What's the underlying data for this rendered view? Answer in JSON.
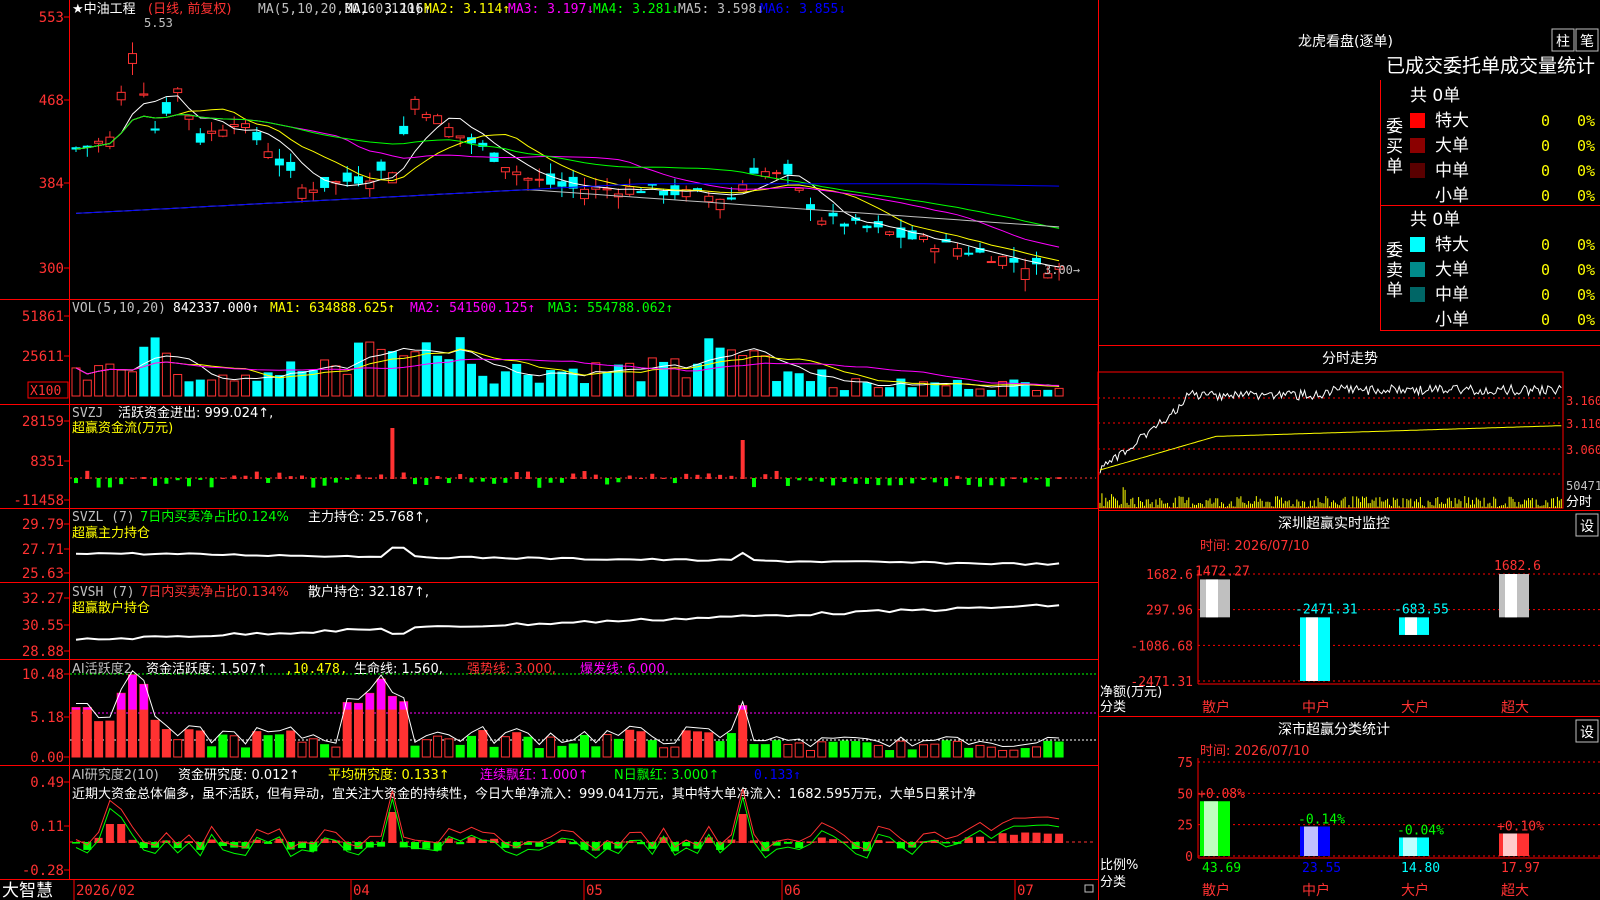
{
  "colors": {
    "up": "#ff3232",
    "down": "#00ffff",
    "bg": "#000000",
    "grid": "#ff0000",
    "white": "#ffffff",
    "yellow": "#ffff00",
    "magenta": "#ff00ff",
    "green": "#00ff00",
    "blue": "#0000ff",
    "gray": "#c0c0c0"
  },
  "main_chart": {
    "title": "★中油工程",
    "mode": "(日线, 前复权)",
    "ma_label": "MA(5,10,20,30,60,120)",
    "ma": [
      {
        "label": "MA1: 3.116↑",
        "color": "#ffffff"
      },
      {
        "label": "MA2: 3.114↑",
        "color": "#ffff00"
      },
      {
        "label": "MA3: 3.197↓",
        "color": "#ff00ff"
      },
      {
        "label": "MA4: 3.281↓",
        "color": "#00ff00"
      },
      {
        "label": "MA5: 3.598↓",
        "color": "#c0c0c0"
      },
      {
        "label": "MA6: 3.855↓",
        "color": "#0000ff"
      }
    ],
    "y_ticks": [
      "553",
      "468",
      "384",
      "300"
    ],
    "high_label": "5.53",
    "last_label": "3.00→"
  },
  "vol_panel": {
    "title": "VOL(5,10,20)",
    "value": "842337.000↑",
    "ma1": "MA1: 634888.625↑",
    "ma2": "MA2: 541500.125↑",
    "ma3": "MA3: 554788.062↑",
    "y_ticks": [
      "51861",
      "25611"
    ],
    "unit": "X100"
  },
  "svzj_panel": {
    "title": "SVZJ",
    "label": "活跃资金进出: 999.024↑,",
    "subtitle": "超赢资金流(万元)",
    "y_ticks": [
      "28159",
      "8351",
      "-11458"
    ]
  },
  "svzl_panel": {
    "title": "SVZL (7)",
    "label": "7日内买卖净占比0.124%",
    "label2": "主力持仓: 25.768↑,",
    "subtitle": "超赢主力持仓",
    "y_ticks": [
      "29.79",
      "27.71",
      "25.63"
    ]
  },
  "svsh_panel": {
    "title": "SVSH (7)",
    "label": "7日内买卖净占比0.134%",
    "label2": "散户持仓: 32.187↑,",
    "subtitle": "超赢散户持仓",
    "y_ticks": [
      "32.27",
      "30.55",
      "28.88"
    ]
  },
  "ai_active_panel": {
    "title": "AI活跃度2",
    "label": "资金活跃度: 1.507↑",
    "v2": ",10.478,",
    "v3": "生命线: 1.560,",
    "v4": "强势线: 3.000,",
    "v5": "爆发线: 6.000,",
    "y_ticks": [
      "10.48",
      "5.18",
      "0.00"
    ]
  },
  "ai_research_panel": {
    "title": "AI研究度2(10)",
    "label": "资金研究度: 0.012↑",
    "v2": "平均研究度: 0.133↑",
    "v3": "连续飘红: 1.000↑",
    "v4": "N日飘红: 3.000↑",
    "v5": "0.133↑",
    "description": "近期大资金总体偏多，虽不活跃，但有异动，宜关注大资金的持续性，今日大单净流入：999.041万元，其中特大单净流入：1682.595万元，大单5日累计净",
    "y_ticks": [
      "0.49",
      "0.11",
      "-0.28"
    ]
  },
  "x_axis": {
    "brand": "大智慧",
    "labels": [
      "2026/02",
      "04",
      "05",
      "06",
      "07"
    ]
  },
  "dragon_tiger": {
    "title": "龙虎看盘(逐单)",
    "btn1": "柱",
    "btn2": "笔",
    "header": "已成交委托单成交量统计",
    "buy": {
      "side": "委买单",
      "total": "共 0单",
      "rows": [
        {
          "name": "特大",
          "val": "0",
          "pct": "0%",
          "color": "#ff0000"
        },
        {
          "name": "大单",
          "val": "0",
          "pct": "0%",
          "color": "#8b0000"
        },
        {
          "name": "中单",
          "val": "0",
          "pct": "0%",
          "color": "#5a0000"
        },
        {
          "name": "小单",
          "val": "0",
          "pct": "0%",
          "color": "#000000"
        }
      ]
    },
    "sell": {
      "side": "委卖单",
      "total": "共 0单",
      "rows": [
        {
          "name": "特大",
          "val": "0",
          "pct": "0%",
          "color": "#00ffff"
        },
        {
          "name": "大单",
          "val": "0",
          "pct": "0%",
          "color": "#008b8b"
        },
        {
          "name": "中单",
          "val": "0",
          "pct": "0%",
          "color": "#006666"
        },
        {
          "name": "小单",
          "val": "0",
          "pct": "0%",
          "color": "#000000"
        }
      ]
    }
  },
  "intraday": {
    "title": "分时走势",
    "y_ticks": [
      "3.160",
      "3.110",
      "3.060"
    ],
    "vol_label": "50471",
    "vol_label2": "分时"
  },
  "realtime_monitor": {
    "title": "深圳超赢实时监控",
    "btn": "设",
    "time": "时间: 2026/07/10",
    "y_ticks": [
      "1682.6",
      "297.96",
      "-1086.68",
      "-2471.31"
    ],
    "y_unit": "净额(万元)",
    "x_unit": "分类",
    "chart_data": {
      "type": "bar",
      "categories": [
        "散户",
        "中户",
        "大户",
        "超大"
      ],
      "values": [
        1472.27,
        -2471.31,
        -683.55,
        1682.6
      ],
      "value_labels": [
        "1472.27",
        "-2471.31",
        "-683.55",
        "1682.6"
      ],
      "ylim": [
        -2471.31,
        1682.6
      ]
    }
  },
  "classify_stats": {
    "title": "深市超赢分类统计",
    "btn": "设",
    "time": "时间: 2026/07/10",
    "y_ticks": [
      "75",
      "50",
      "25",
      "0"
    ],
    "y_unit": "比例%",
    "x_unit": "分类",
    "chart_data": {
      "type": "bar",
      "categories": [
        "散户",
        "中户",
        "大户",
        "超大"
      ],
      "values": [
        43.69,
        23.55,
        14.8,
        17.97
      ],
      "value_labels": [
        "43.69",
        "23.55",
        "14.80",
        "17.97"
      ],
      "changes": [
        "+0.08%",
        "-0.14%",
        "-0.04%",
        "+0.10%"
      ],
      "ylim": [
        0,
        75
      ]
    }
  }
}
